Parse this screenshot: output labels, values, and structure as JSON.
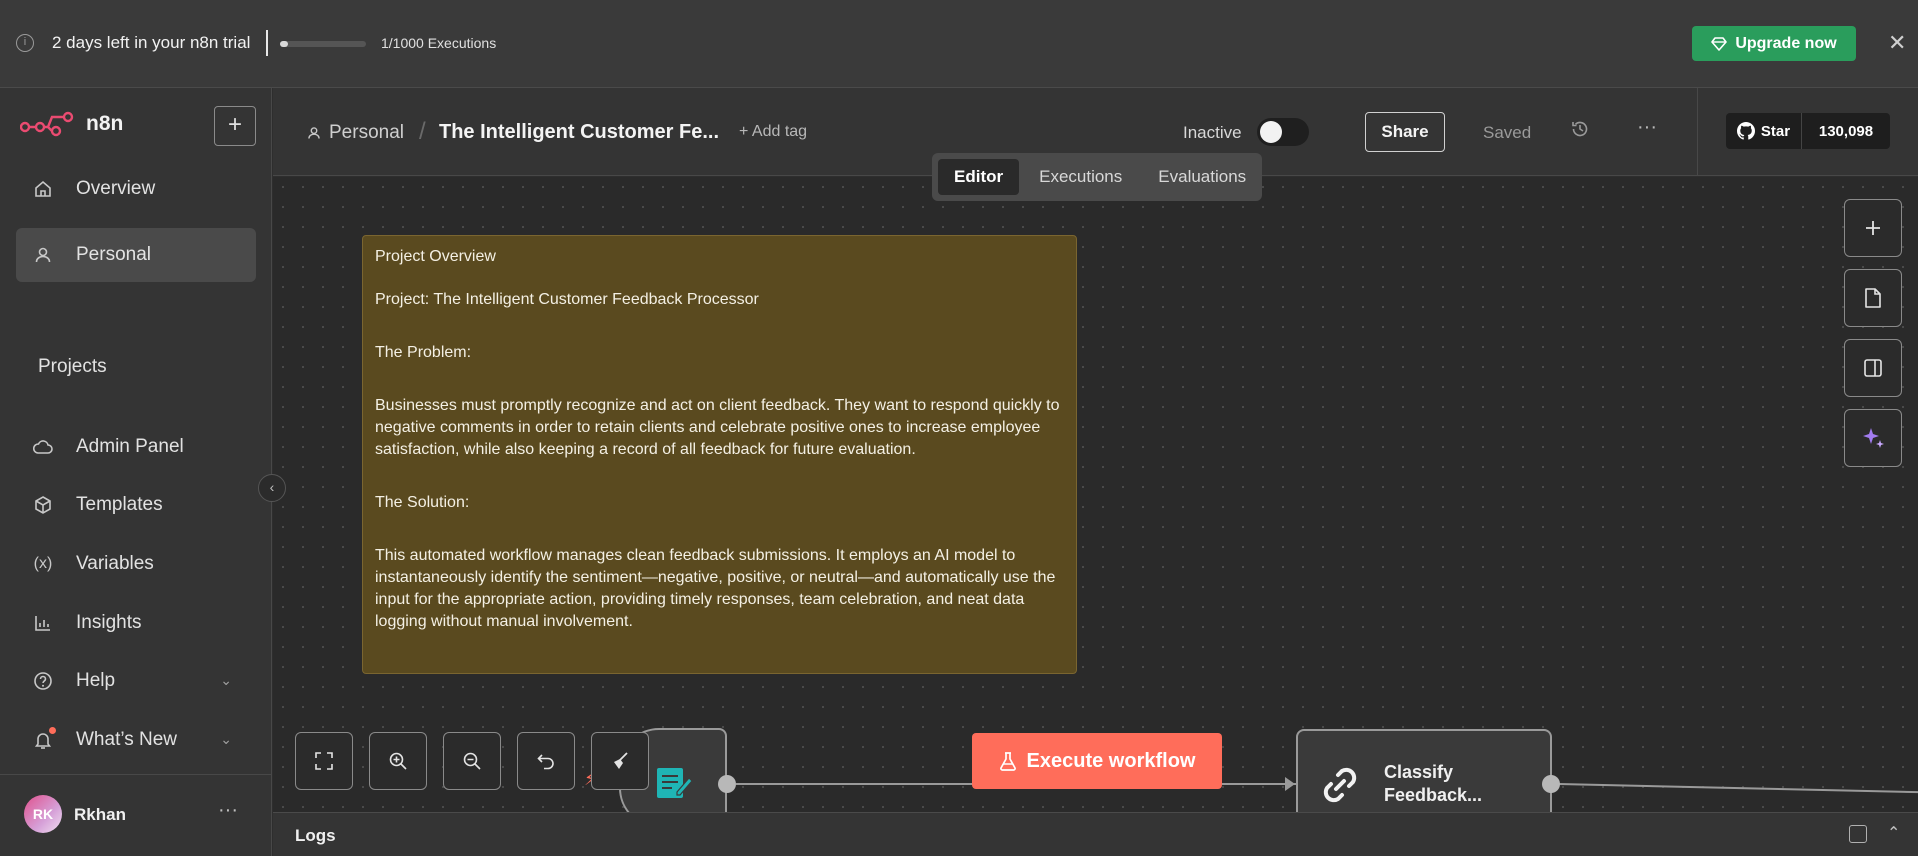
{
  "banner": {
    "trial_text": "2 days left in your n8n trial",
    "executions_used": 1,
    "executions_limit": 1000,
    "executions_text": "1/1000 Executions",
    "upgrade_label": "Upgrade now",
    "accent_color": "#2a9d5c"
  },
  "sidebar": {
    "logo_text": "n8n",
    "nav": [
      {
        "label": "Overview",
        "icon": "home-icon"
      },
      {
        "label": "Personal",
        "icon": "user-icon",
        "active": true
      }
    ],
    "projects_heading": "Projects",
    "bottom_nav": [
      {
        "label": "Admin Panel",
        "icon": "cloud-icon"
      },
      {
        "label": "Templates",
        "icon": "box-icon"
      },
      {
        "label": "Variables",
        "icon": "variable-icon"
      },
      {
        "label": "Insights",
        "icon": "chart-icon"
      },
      {
        "label": "Help",
        "icon": "help-icon"
      },
      {
        "label": "What’s New",
        "icon": "bell-icon"
      }
    ],
    "user": {
      "initials": "RK",
      "name": "Rkhan"
    }
  },
  "header": {
    "breadcrumb_project": "Personal",
    "workflow_title": "The Intelligent Customer Fe...",
    "add_tag": "+ Add tag",
    "status_label": "Inactive",
    "active": false,
    "share_label": "Share",
    "saved_label": "Saved",
    "github": {
      "star_label": "Star",
      "count": "130,098"
    }
  },
  "tabs": [
    {
      "label": "Editor",
      "active": true
    },
    {
      "label": "Executions",
      "active": false
    },
    {
      "label": "Evaluations",
      "active": false
    }
  ],
  "sticky_note": {
    "heading": "Project Overview",
    "project_line": "Project: The Intelligent Customer Feedback Processor",
    "problem_heading": "The Problem:",
    "problem_text": "Businesses must promptly recognize and act on client feedback. They want to respond quickly to negative comments in order to retain clients and celebrate positive ones to increase employee satisfaction, while also keeping a record of all feedback for future evaluation.",
    "solution_heading": "The Solution:",
    "solution_text": "This automated workflow manages clean feedback submissions. It employs an AI model to instantaneously identify the sentiment—negative, positive, or neutral—and automatically use the input for the appropriate action, providing timely responses, team celebration, and neat data logging without manual involvement.",
    "color": "#5a4a1f"
  },
  "canvas": {
    "execute_label": "Execute workflow",
    "execute_color": "#ff6d5a",
    "classify_node_label": "Classify Feedback..."
  },
  "logs": {
    "label": "Logs"
  }
}
